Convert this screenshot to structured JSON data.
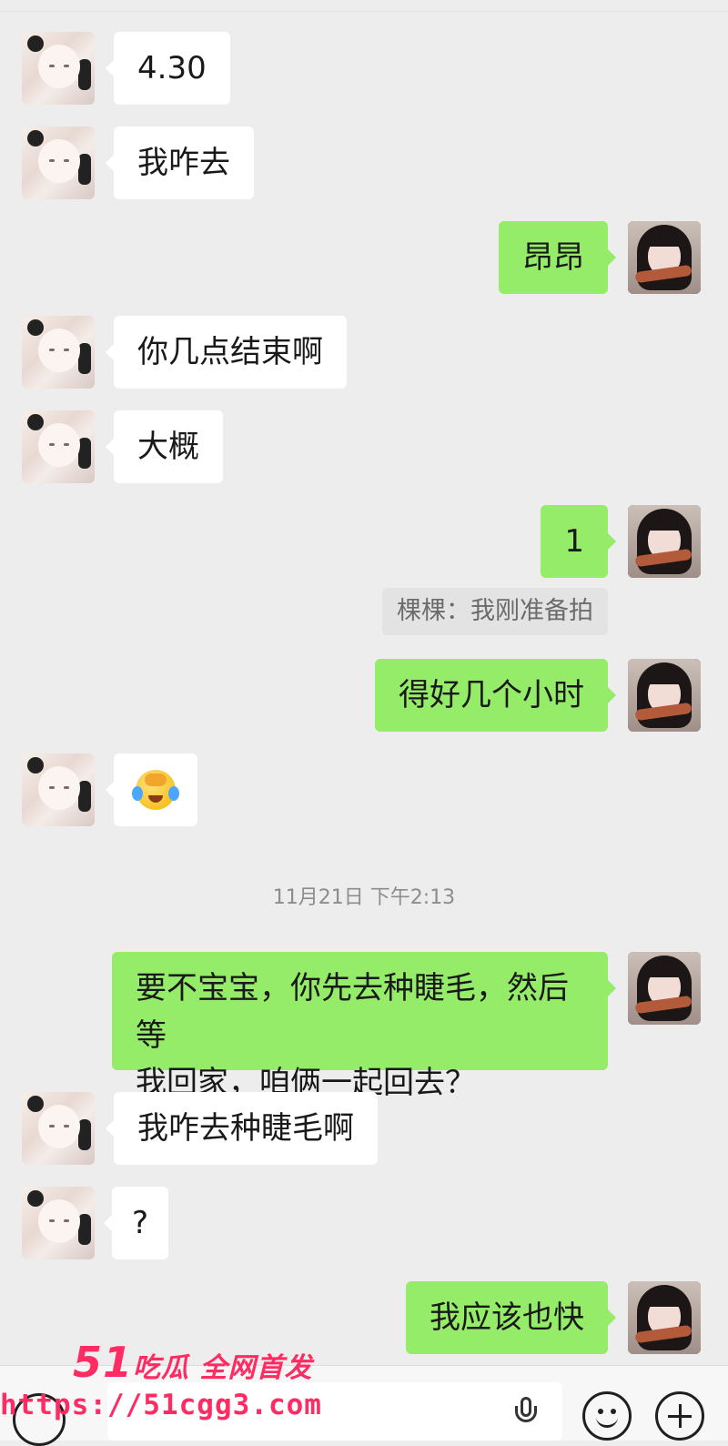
{
  "messages": [
    {
      "side": "left",
      "text": "4.30"
    },
    {
      "side": "left",
      "text": "我咋去"
    },
    {
      "side": "right",
      "text": "昂昂"
    },
    {
      "side": "left",
      "text": "你几点结束啊"
    },
    {
      "side": "left",
      "text": "大概"
    },
    {
      "side": "right",
      "text": "1"
    },
    {
      "quote": "棵棵：我刚准备拍"
    },
    {
      "side": "right",
      "text": "得好几个小时"
    },
    {
      "side": "left",
      "emoji": "facepalm-crying-emoji"
    },
    {
      "timestamp": "11月21日 下午2:13"
    },
    {
      "side": "right",
      "text_line1": "要不宝宝，你先去种睫毛，然后等",
      "text_line2": "我回家，咱俩一起回去？"
    },
    {
      "side": "left",
      "text": "我咋去种睫毛啊"
    },
    {
      "side": "left",
      "text": "?"
    },
    {
      "side": "right",
      "text": "我应该也快"
    }
  ],
  "watermark": {
    "line1_num": "51",
    "line1_text": "吃瓜 全网首发",
    "line2": "https://51cgg3.com"
  },
  "input_bar": {
    "icons": [
      "voice-icon",
      "microphone-icon",
      "emoji-icon",
      "plus-icon"
    ]
  },
  "colors": {
    "background": "#ededed",
    "bubble_self": "#95ec69",
    "bubble_other": "#ffffff",
    "watermark": "#ff2c63"
  }
}
